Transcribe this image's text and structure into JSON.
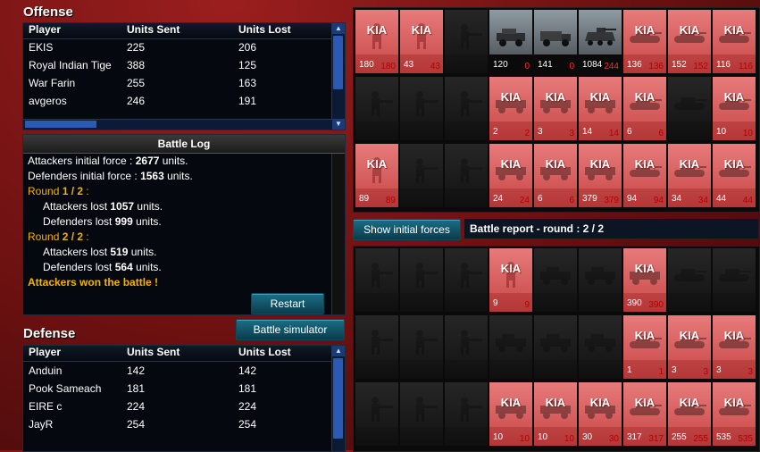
{
  "offense": {
    "title": "Offense",
    "headers": [
      "Player",
      "Units Sent",
      "Units Lost"
    ],
    "rows": [
      {
        "player": "EKIS",
        "sent": "225",
        "lost": "206"
      },
      {
        "player": "Royal Indian Tige",
        "sent": "388",
        "lost": "125"
      },
      {
        "player": "War Farin",
        "sent": "255",
        "lost": "163"
      },
      {
        "player": "avgeros",
        "sent": "246",
        "lost": "191"
      }
    ]
  },
  "battle_log": {
    "title": "Battle Log",
    "attackers_initial_prefix": "Attackers initial force : ",
    "attackers_initial_value": "2677",
    "attackers_initial_suffix": " units.",
    "defenders_initial_prefix": "Defenders initial force : ",
    "defenders_initial_value": "1563",
    "defenders_initial_suffix": " units.",
    "round1_prefix": "Round ",
    "round1_value": "1 / 2",
    "round1_suffix": " :",
    "r1_att_prefix": "Attackers lost ",
    "r1_att_value": "1057",
    "r1_def_prefix": "Defenders lost ",
    "r1_def_value": "999",
    "round2_prefix": "Round ",
    "round2_value": "2 / 2",
    "round2_suffix": " :",
    "r2_att_prefix": "Attackers lost ",
    "r2_att_value": "519",
    "r2_def_prefix": "Defenders lost ",
    "r2_def_value": "564",
    "units_suffix": " units.",
    "result": "Attackers won the battle !",
    "restart_label": "Restart"
  },
  "battle_simulator_label": "Battle simulator",
  "defense": {
    "title": "Defense",
    "headers": [
      "Player",
      "Units Sent",
      "Units Lost"
    ],
    "rows": [
      {
        "player": "Anduin",
        "sent": "142",
        "lost": "142"
      },
      {
        "player": "Pook Sameach",
        "sent": "181",
        "lost": "181"
      },
      {
        "player": "EIRE c",
        "sent": "224",
        "lost": "224"
      },
      {
        "player": "JayR",
        "sent": "254",
        "lost": "254"
      }
    ]
  },
  "show_initial_forces_label": "Show initial forces",
  "battle_report_label": "Battle report - round : 2 / 2",
  "kia_label": "KIA",
  "attacker_units": [
    [
      {
        "state": "kia",
        "type": "infantry",
        "sent": "180",
        "lost": "180"
      },
      {
        "state": "kia",
        "type": "infantry",
        "sent": "43",
        "lost": "43"
      },
      {
        "state": "empty",
        "type": "soldier",
        "sent": "",
        "lost": ""
      },
      {
        "state": "live",
        "type": "jeep",
        "sent": "120",
        "lost": "0"
      },
      {
        "state": "live",
        "type": "truck",
        "sent": "141",
        "lost": "0"
      },
      {
        "state": "live",
        "type": "apc",
        "sent": "1084",
        "lost": "244"
      },
      {
        "state": "kia",
        "type": "tank",
        "sent": "136",
        "lost": "136"
      },
      {
        "state": "kia",
        "type": "tank",
        "sent": "152",
        "lost": "152"
      },
      {
        "state": "kia",
        "type": "tank",
        "sent": "116",
        "lost": "116"
      }
    ],
    [
      {
        "state": "empty",
        "type": "soldier",
        "sent": "",
        "lost": ""
      },
      {
        "state": "empty",
        "type": "soldier",
        "sent": "",
        "lost": ""
      },
      {
        "state": "empty",
        "type": "soldier",
        "sent": "",
        "lost": ""
      },
      {
        "state": "kia",
        "type": "vehicle",
        "sent": "2",
        "lost": "2"
      },
      {
        "state": "kia",
        "type": "vehicle",
        "sent": "3",
        "lost": "3"
      },
      {
        "state": "kia",
        "type": "vehicle",
        "sent": "14",
        "lost": "14"
      },
      {
        "state": "kia",
        "type": "tank",
        "sent": "6",
        "lost": "6"
      },
      {
        "state": "empty",
        "type": "tank",
        "sent": "",
        "lost": ""
      },
      {
        "state": "kia",
        "type": "tank",
        "sent": "10",
        "lost": "10"
      }
    ],
    [
      {
        "state": "kia",
        "type": "infantry",
        "sent": "89",
        "lost": "89"
      },
      {
        "state": "empty",
        "type": "soldier",
        "sent": "",
        "lost": ""
      },
      {
        "state": "empty",
        "type": "soldier",
        "sent": "",
        "lost": ""
      },
      {
        "state": "kia",
        "type": "vehicle",
        "sent": "24",
        "lost": "24"
      },
      {
        "state": "kia",
        "type": "vehicle",
        "sent": "6",
        "lost": "6"
      },
      {
        "state": "kia",
        "type": "vehicle",
        "sent": "379",
        "lost": "379"
      },
      {
        "state": "kia",
        "type": "tank",
        "sent": "94",
        "lost": "94"
      },
      {
        "state": "kia",
        "type": "tank",
        "sent": "34",
        "lost": "34"
      },
      {
        "state": "kia",
        "type": "tank",
        "sent": "44",
        "lost": "44"
      }
    ]
  ],
  "defender_units": [
    [
      {
        "state": "empty",
        "type": "soldier",
        "sent": "",
        "lost": ""
      },
      {
        "state": "empty",
        "type": "soldier",
        "sent": "",
        "lost": ""
      },
      {
        "state": "empty",
        "type": "soldier",
        "sent": "",
        "lost": ""
      },
      {
        "state": "kia",
        "type": "infantry",
        "sent": "9",
        "lost": "9"
      },
      {
        "state": "empty",
        "type": "vehicle",
        "sent": "",
        "lost": ""
      },
      {
        "state": "empty",
        "type": "vehicle",
        "sent": "",
        "lost": ""
      },
      {
        "state": "kia",
        "type": "vehicle",
        "sent": "390",
        "lost": "390"
      },
      {
        "state": "empty",
        "type": "tank",
        "sent": "",
        "lost": ""
      },
      {
        "state": "empty",
        "type": "tank",
        "sent": "",
        "lost": ""
      }
    ],
    [
      {
        "state": "empty",
        "type": "soldier",
        "sent": "",
        "lost": ""
      },
      {
        "state": "empty",
        "type": "soldier",
        "sent": "",
        "lost": ""
      },
      {
        "state": "empty",
        "type": "soldier",
        "sent": "",
        "lost": ""
      },
      {
        "state": "empty",
        "type": "vehicle",
        "sent": "",
        "lost": ""
      },
      {
        "state": "empty",
        "type": "vehicle",
        "sent": "",
        "lost": ""
      },
      {
        "state": "empty",
        "type": "vehicle",
        "sent": "",
        "lost": ""
      },
      {
        "state": "kia",
        "type": "tank",
        "sent": "1",
        "lost": "1"
      },
      {
        "state": "kia",
        "type": "tank",
        "sent": "3",
        "lost": "3"
      },
      {
        "state": "kia",
        "type": "tank",
        "sent": "3",
        "lost": "3"
      }
    ],
    [
      {
        "state": "empty",
        "type": "soldier",
        "sent": "",
        "lost": ""
      },
      {
        "state": "empty",
        "type": "soldier",
        "sent": "",
        "lost": ""
      },
      {
        "state": "empty",
        "type": "soldier",
        "sent": "",
        "lost": ""
      },
      {
        "state": "kia",
        "type": "vehicle",
        "sent": "10",
        "lost": "10"
      },
      {
        "state": "kia",
        "type": "vehicle",
        "sent": "10",
        "lost": "10"
      },
      {
        "state": "kia",
        "type": "vehicle",
        "sent": "30",
        "lost": "30"
      },
      {
        "state": "kia",
        "type": "tank",
        "sent": "317",
        "lost": "317"
      },
      {
        "state": "kia",
        "type": "tank",
        "sent": "255",
        "lost": "255"
      },
      {
        "state": "kia",
        "type": "tank",
        "sent": "535",
        "lost": "535"
      }
    ]
  ]
}
